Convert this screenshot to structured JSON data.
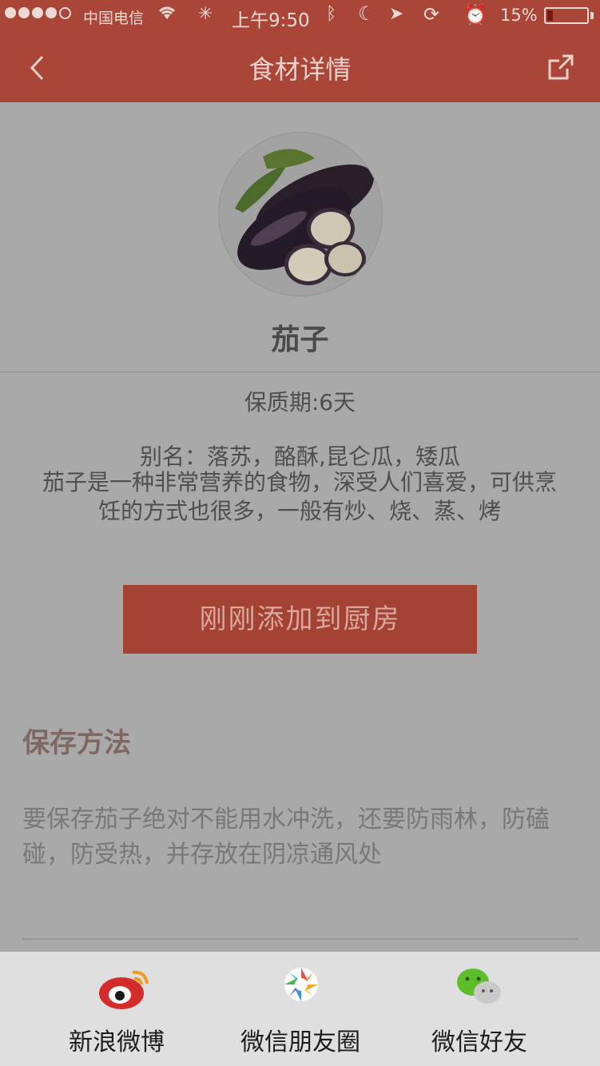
{
  "status_bar": {
    "carrier": "中国电信",
    "time": "上午9:50",
    "battery_percent": "15%",
    "battery_level": 0.15
  },
  "nav": {
    "title": "食材详情",
    "back_icon": "chevron-left-icon",
    "share_icon": "share-out-icon"
  },
  "food": {
    "name": "茄子",
    "shelf_life": "保质期:6天",
    "alias": "别名：落苏，酪酥,昆仑瓜，矮瓜",
    "intro": "茄子是一种非常营养的食物，深受人们喜爱，可供烹饪的方式也很多，一般有炒、烧、蒸、烤"
  },
  "action": {
    "add_button_label": "刚刚添加到厨房"
  },
  "storage": {
    "title": "保存方法",
    "body": "要保存茄子绝对不能用水冲洗，还要防雨林，防磕碰，防受热，并存放在阴凉通风处"
  },
  "share_sheet": {
    "items": [
      {
        "label": "新浪微博",
        "icon": "weibo-icon"
      },
      {
        "label": "微信朋友圈",
        "icon": "wechat-moments-icon"
      },
      {
        "label": "微信好友",
        "icon": "wechat-icon"
      }
    ]
  },
  "colors": {
    "nav_bar": "#a94638",
    "overlay": "#a9a9a9",
    "add_button": "#a44334",
    "share_sheet_bg": "#dfdfdf"
  }
}
